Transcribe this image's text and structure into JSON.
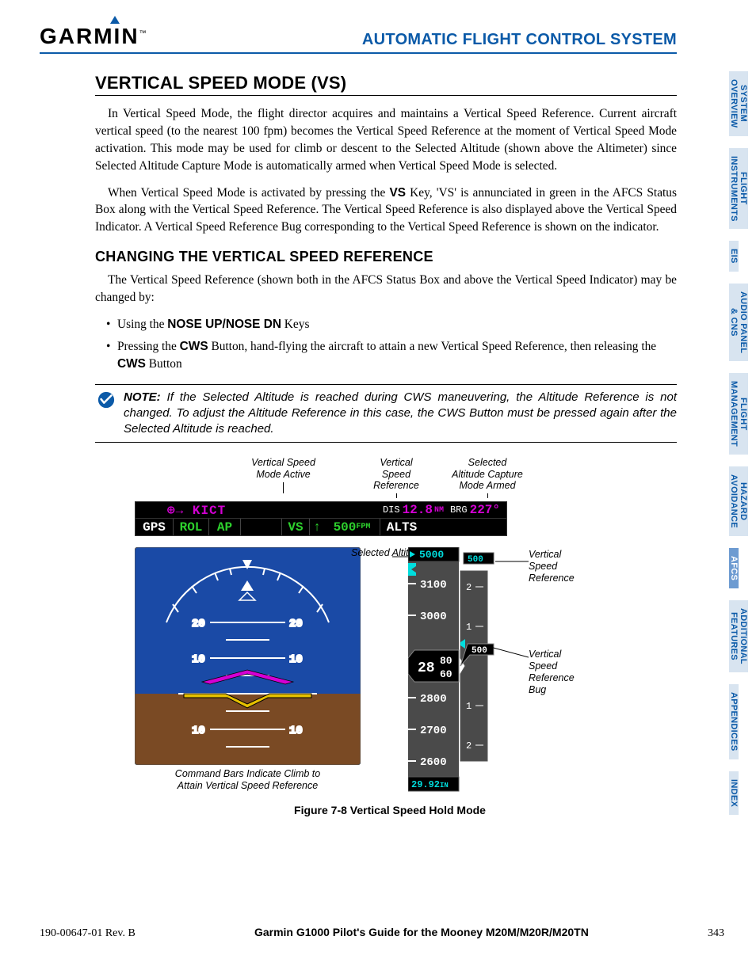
{
  "header": {
    "logo_text": "GARMIN",
    "section_title": "AUTOMATIC FLIGHT CONTROL SYSTEM"
  },
  "tabs": [
    {
      "label": "SYSTEM\nOVERVIEW",
      "active": false
    },
    {
      "label": "FLIGHT\nINSTRUMENTS",
      "active": false
    },
    {
      "label": "EIS",
      "active": false
    },
    {
      "label": "AUDIO PANEL\n& CNS",
      "active": false
    },
    {
      "label": "FLIGHT\nMANAGEMENT",
      "active": false
    },
    {
      "label": "HAZARD\nAVOIDANCE",
      "active": false
    },
    {
      "label": "AFCS",
      "active": true
    },
    {
      "label": "ADDITIONAL\nFEATURES",
      "active": false
    },
    {
      "label": "APPENDICES",
      "active": false
    },
    {
      "label": "INDEX",
      "active": false
    }
  ],
  "title": "VERTICAL SPEED MODE (VS)",
  "para1_a": "In Vertical Speed Mode, the flight director acquires and maintains a Vertical Speed Reference.  Current aircraft vertical speed (to the nearest 100 fpm) becomes the Vertical Speed Reference at the moment of Vertical Speed Mode activation.  This mode may be used for climb or descent to the Selected Altitude (shown above the Altimeter) since Selected Altitude Capture Mode is automatically armed when Vertical Speed Mode is selected.",
  "para2_a": "When Vertical Speed Mode is activated by pressing the ",
  "para2_vs": "VS",
  "para2_b": " Key, 'VS' is annunciated in green in the AFCS Status Box along with the Vertical Speed Reference.  The Vertical Speed Reference is also displayed above the Vertical Speed Indicator.  A Vertical Speed Reference Bug corresponding to the Vertical Speed Reference is shown on the indicator.",
  "subheading": "CHANGING THE VERTICAL SPEED REFERENCE",
  "para3": "The Vertical Speed Reference (shown both in the AFCS Status Box and above the Vertical Speed Indicator) may be changed by:",
  "bullet1_a": "Using the ",
  "bullet1_b": "NOSE UP/NOSE DN",
  "bullet1_c": " Keys",
  "bullet2_a": "Pressing the ",
  "bullet2_b": "CWS",
  "bullet2_c": " Button, hand-flying the aircraft to attain a new Vertical Speed Reference, then releasing the ",
  "bullet2_d": "CWS",
  "bullet2_e": " Button",
  "note_label": "NOTE:",
  "note_text": " If the Selected Altitude is reached during CWS maneuvering, the Altitude Reference is not changed.  To adjust the Altitude Reference in this case, the CWS Button must be pressed again after the Selected Altitude is reached.",
  "fig": {
    "callout_vs_mode": "Vertical Speed\nMode Active",
    "callout_vs_ref": "Vertical\nSpeed\nReference",
    "callout_alt_armed": "Selected\nAltitude Capture\nMode Armed",
    "status": {
      "waypoint_sym": "⊕→",
      "waypoint": "KICT",
      "dis_label": "DIS",
      "dis_value": "12.8",
      "dis_unit": "NM",
      "brg_label": "BRG",
      "brg_value": "227°",
      "gps": "GPS",
      "rol": "ROL",
      "ap": "AP",
      "vs": "VS",
      "arrow": "↑",
      "fpm_value": "500",
      "fpm_unit": "FPM",
      "alts": "ALTS"
    },
    "attitude": {
      "pitch_labels": [
        "20",
        "10",
        "10"
      ],
      "command_bars_caption": "Command Bars Indicate Climb to\nAttain Vertical Speed Reference"
    },
    "alt_tape": {
      "selected_alt": "5000",
      "vs_ref_box": "500",
      "ticks_upper": [
        "3100",
        "3000"
      ],
      "curr_big": "28",
      "curr_top": "80",
      "curr_bot": "60",
      "ticks_lower": [
        "2800",
        "2700",
        "2600"
      ],
      "baro": "29.92",
      "baro_unit": "IN",
      "vsi_labels": [
        "2",
        "1",
        "1",
        "2"
      ],
      "vsi_value": "500"
    },
    "side_callouts": {
      "selected_alt": "Selected\nAltitude",
      "vs_ref": "Vertical\nSpeed\nReference",
      "vs_ref_bug": "Vertical\nSpeed\nReference\nBug"
    },
    "caption": "Figure 7-8  Vertical Speed Hold Mode"
  },
  "footer": {
    "rev": "190-00647-01  Rev. B",
    "guide": "Garmin G1000 Pilot's Guide for the Mooney M20M/M20R/M20TN",
    "page": "343"
  }
}
